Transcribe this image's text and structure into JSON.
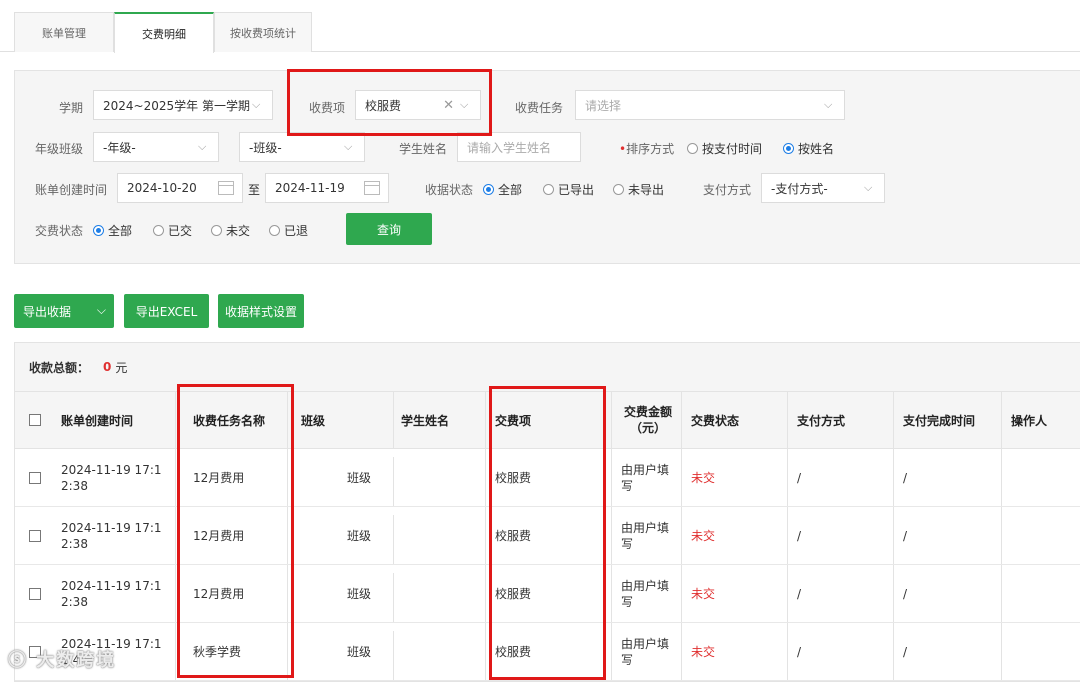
{
  "tabs": [
    "账单管理",
    "交费明细",
    "按收费项统计"
  ],
  "filters": {
    "term_label": "学期",
    "term_value": "2024~2025学年 第一学期",
    "item_label": "收费项",
    "item_value": "校服费",
    "task_label": "收费任务",
    "task_placeholder": "请选择",
    "grade_label": "年级班级",
    "grade_value": "-年级-",
    "class_value": "-班级-",
    "student_label": "学生姓名",
    "student_placeholder": "请输入学生姓名",
    "sort_label": "排序方式",
    "sort_options": [
      "按支付时间",
      "按姓名"
    ],
    "date_label": "账单创建时间",
    "date_from": "2024-10-20",
    "date_to_sep": "至",
    "date_to": "2024-11-19",
    "receipt_label": "收据状态",
    "receipt_options": [
      "全部",
      "已导出",
      "未导出"
    ],
    "paymethod_label": "支付方式",
    "paymethod_value": "-支付方式-",
    "paystatus_label": "交费状态",
    "paystatus_options": [
      "全部",
      "已交",
      "未交",
      "已退"
    ],
    "query_button": "查询"
  },
  "actions": {
    "export_receipt": "导出收据",
    "export_excel": "导出EXCEL",
    "receipt_style": "收据样式设置"
  },
  "summary": {
    "label": "收款总额：",
    "amount": "0",
    "unit": "元"
  },
  "table": {
    "headers": [
      "账单创建时间",
      "收费任务名称",
      "班级",
      "学生姓名",
      "交费项",
      "交费金额（元）",
      "交费状态",
      "支付方式",
      "支付完成时间",
      "操作人"
    ],
    "rows": [
      {
        "time": "2024-11-19 17:12:38",
        "task": "12月费用",
        "class": "班级",
        "student": "",
        "item": "校服费",
        "amount": "由用户填写",
        "status": "未交",
        "method": "/",
        "paid_time": "/",
        "operator": ""
      },
      {
        "time": "2024-11-19 17:12:38",
        "task": "12月费用",
        "class": "班级",
        "student": "",
        "item": "校服费",
        "amount": "由用户填写",
        "status": "未交",
        "method": "/",
        "paid_time": "/",
        "operator": ""
      },
      {
        "time": "2024-11-19 17:12:38",
        "task": "12月费用",
        "class": "班级",
        "student": "",
        "item": "校服费",
        "amount": "由用户填写",
        "status": "未交",
        "method": "/",
        "paid_time": "/",
        "operator": ""
      },
      {
        "time": "2024-11-19 17:11:4",
        "task": "秋季学费",
        "class": "班级",
        "student": "",
        "item": "校服费",
        "amount": "由用户填写",
        "status": "未交",
        "method": "/",
        "paid_time": "/",
        "operator": ""
      }
    ]
  },
  "watermark": "大数跨境",
  "colors": {
    "accent": "#2fa84f",
    "alert": "#e03030",
    "radio": "#1e7ee6",
    "highlight_box": "#e01818"
  }
}
